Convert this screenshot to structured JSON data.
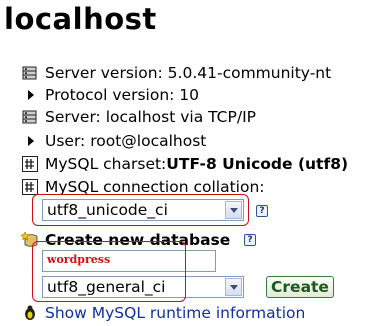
{
  "header": {
    "title": "localhost"
  },
  "server_info": {
    "server_version": "Server version: 5.0.41-community-nt",
    "protocol_version": "Protocol version: 10",
    "server": "Server: localhost via TCP/IP",
    "user": "User: root@localhost",
    "charset_label": "MySQL charset: ",
    "charset_value": "UTF-8 Unicode (utf8)",
    "collation_label": "MySQL connection collation:"
  },
  "collation_select": {
    "value": "utf8_unicode_ci"
  },
  "create_db": {
    "heading": "Create new database",
    "name_value": "wordpress",
    "collation_value": "utf8_general_ci",
    "create_label": "Create"
  },
  "links": {
    "runtime_info": "Show MySQL runtime information"
  },
  "icons": {
    "server": "server-icon",
    "bullet": "triangle-bullet-icon",
    "charset": "charset-icon",
    "new_db": "new-database-icon",
    "help": "help-icon",
    "runtime": "runtime-info-icon"
  },
  "colors": {
    "highlight": "#d01010",
    "link": "#1030a0",
    "button_text": "#1a5a1a"
  }
}
